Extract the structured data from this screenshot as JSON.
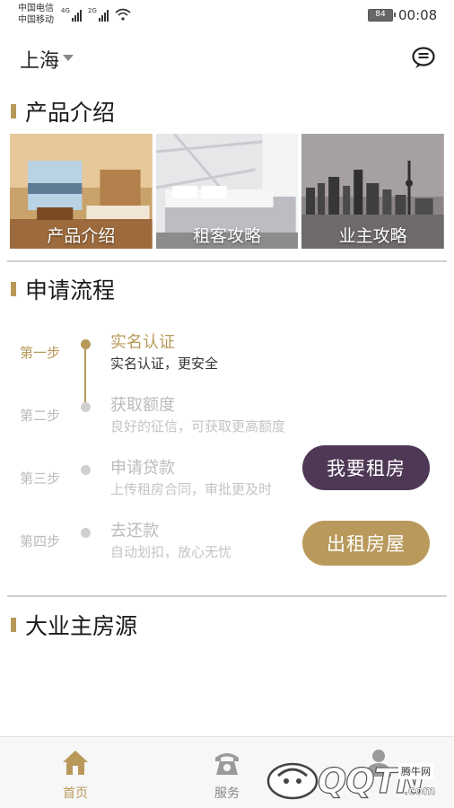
{
  "status_bar": {
    "carrier1": "中国电信",
    "carrier2": "中国移动",
    "net1": "4G",
    "net2": "2G",
    "battery": "84",
    "time": "00:08"
  },
  "header": {
    "city": "上海",
    "icon": "message-icon"
  },
  "product_section": {
    "title": "产品介绍",
    "cards": [
      {
        "label": "产品介绍"
      },
      {
        "label": "租客攻略"
      },
      {
        "label": "业主攻略"
      }
    ]
  },
  "process_section": {
    "title": "申请流程",
    "steps": [
      {
        "num": "第一步",
        "title": "实名认证",
        "desc": "实名认证，更安全"
      },
      {
        "num": "第二步",
        "title": "获取额度",
        "desc": "良好的征信，可获取更高额度"
      },
      {
        "num": "第三步",
        "title": "申请贷款",
        "desc": "上传租房合同，审批更及时"
      },
      {
        "num": "第四步",
        "title": "去还款",
        "desc": "自动划扣，放心无忧"
      }
    ],
    "rent_button": "我要租房",
    "lease_button": "出租房屋"
  },
  "landlord_section": {
    "title": "大业主房源"
  },
  "tabbar": {
    "items": [
      {
        "label": "首页",
        "icon": "home-icon"
      },
      {
        "label": "服务",
        "icon": "phone-icon"
      },
      {
        "label": "",
        "icon": "person-icon"
      }
    ]
  },
  "watermark": {
    "text": "QQTN",
    "suffix": ".com",
    "cn": "腾牛网"
  },
  "colors": {
    "accent_gold": "#b8995a",
    "accent_purple": "#4e3856"
  }
}
